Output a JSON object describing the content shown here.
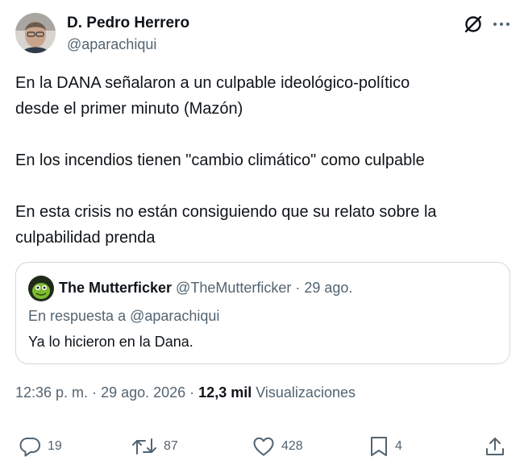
{
  "author": {
    "name": "D. Pedro Herrero",
    "handle": "@aparachiqui"
  },
  "tweet": {
    "paragraphs": [
      "En la DANA señalaron a un culpable ideológico-político\ndesde el primer minuto (Mazón)",
      "En los incendios tienen \"cambio climático\" como culpable",
      "En esta crisis no están consiguiendo que su relato sobre la\nculpabilidad prenda"
    ]
  },
  "quote": {
    "name": "The Mutterficker",
    "handle": "@TheMutterficker",
    "separator": " · ",
    "date": "29 ago.",
    "reply_to": "En respuesta a @aparachiqui",
    "text": "Ya lo hicieron en la Dana."
  },
  "meta": {
    "time": "12:36 p. m.",
    "separator1": " · ",
    "date": "29 ago. 2026",
    "separator2": " · ",
    "views_count": "12,3 mil",
    "views_label": "Visualizaciones"
  },
  "actions": {
    "replies": "19",
    "reposts": "87",
    "likes": "428",
    "bookmarks": "4"
  },
  "icons": {
    "header_right": [
      "grok-icon",
      "more-icon"
    ],
    "actions": [
      "reply-icon",
      "repost-icon",
      "like-icon",
      "bookmark-icon",
      "share-icon"
    ]
  },
  "colors": {
    "text_primary": "#0f1419",
    "text_secondary": "#536471",
    "border": "#cfd9de"
  }
}
